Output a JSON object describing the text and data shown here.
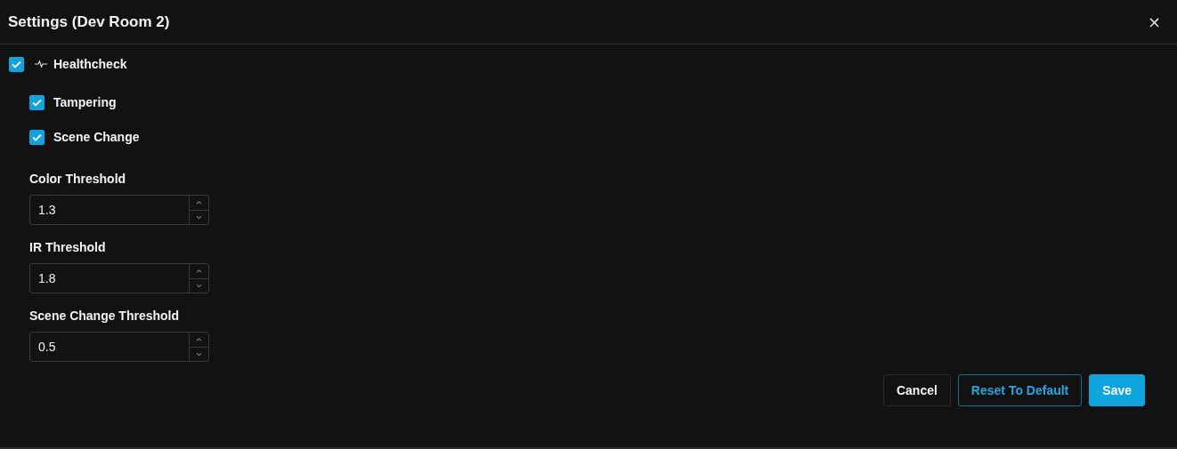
{
  "dialog": {
    "title": "Settings (Dev Room 2)",
    "close": "×"
  },
  "healthcheck": {
    "label": "Healthcheck",
    "checked": true,
    "options": [
      {
        "label": "Tampering",
        "checked": true
      },
      {
        "label": "Scene Change",
        "checked": true
      }
    ]
  },
  "fields": [
    {
      "label": "Color Threshold",
      "value": "1.3"
    },
    {
      "label": "IR Threshold",
      "value": "1.8"
    },
    {
      "label": "Scene Change Threshold",
      "value": "0.5"
    }
  ],
  "buttons": [
    {
      "label": "Cancel",
      "kind": "secondary"
    },
    {
      "label": "Reset To Default",
      "kind": "outline"
    },
    {
      "label": "Save",
      "kind": "primary"
    }
  ]
}
